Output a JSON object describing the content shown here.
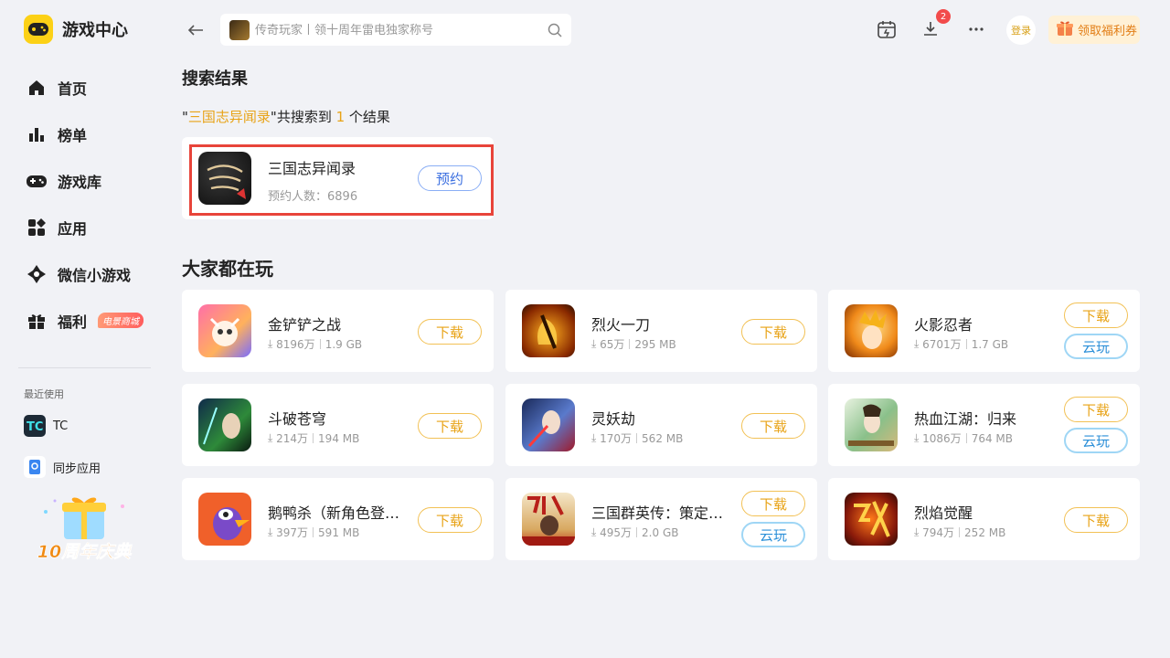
{
  "app": {
    "title": "游戏中心"
  },
  "colors": {
    "accent": "#e8a317",
    "cloud": "#2b8fd8",
    "highlight_frame": "#e8443a",
    "brand": "#fcd116"
  },
  "sidebar": {
    "items": [
      {
        "label": "首页",
        "icon": "home-icon"
      },
      {
        "label": "榜单",
        "icon": "chart-icon"
      },
      {
        "label": "游戏库",
        "icon": "gamepad-icon"
      },
      {
        "label": "应用",
        "icon": "apps-icon"
      },
      {
        "label": "微信小游戏",
        "icon": "wechat-minigame-icon"
      },
      {
        "label": "福利",
        "icon": "gift-icon",
        "badge": "电景商城"
      }
    ],
    "recent_title": "最近使用",
    "recent": [
      {
        "label": "TC",
        "icon": "tc-app-icon"
      },
      {
        "label": "同步应用",
        "icon": "sync-app-icon"
      }
    ],
    "promo_text": "10周年庆典"
  },
  "topbar": {
    "search_placeholder": "传奇玩家丨领十周年雷电独家称号",
    "download_count": "2",
    "login_label": "登录",
    "coupon_label": "领取福利券"
  },
  "search": {
    "heading": "搜索结果",
    "query": "三国志异闻录",
    "summary_prefix": "\"",
    "summary_mid": "\"共搜索到 ",
    "count": "1",
    "summary_suffix": " 个结果",
    "result": {
      "name": "三国志异闻录",
      "reservations_label": "预约人数：6896",
      "action": "预约"
    }
  },
  "popular": {
    "heading": "大家都在玩",
    "games": [
      {
        "name": "金铲铲之战",
        "downloads": "8196万",
        "size": "1.9 GB",
        "download": "下载",
        "cloud": ""
      },
      {
        "name": "烈火一刀",
        "downloads": "65万",
        "size": "295 MB",
        "download": "下载",
        "cloud": ""
      },
      {
        "name": "火影忍者",
        "downloads": "6701万",
        "size": "1.7 GB",
        "download": "下载",
        "cloud": "云玩"
      },
      {
        "name": "斗破苍穹",
        "downloads": "214万",
        "size": "194 MB",
        "download": "下载",
        "cloud": ""
      },
      {
        "name": "灵妖劫",
        "downloads": "170万",
        "size": "562 MB",
        "download": "下载",
        "cloud": ""
      },
      {
        "name": "热血江湖：归来",
        "downloads": "1086万",
        "size": "764 MB",
        "download": "下载",
        "cloud": "云玩"
      },
      {
        "name": "鹅鸭杀（新角色登…",
        "downloads": "397万",
        "size": "591 MB",
        "download": "下载",
        "cloud": ""
      },
      {
        "name": "三国群英传：策定…",
        "downloads": "495万",
        "size": "2.0 GB",
        "download": "下载",
        "cloud": "云玩"
      },
      {
        "name": "烈焰觉醒",
        "downloads": "794万",
        "size": "252 MB",
        "download": "下载",
        "cloud": ""
      }
    ]
  }
}
